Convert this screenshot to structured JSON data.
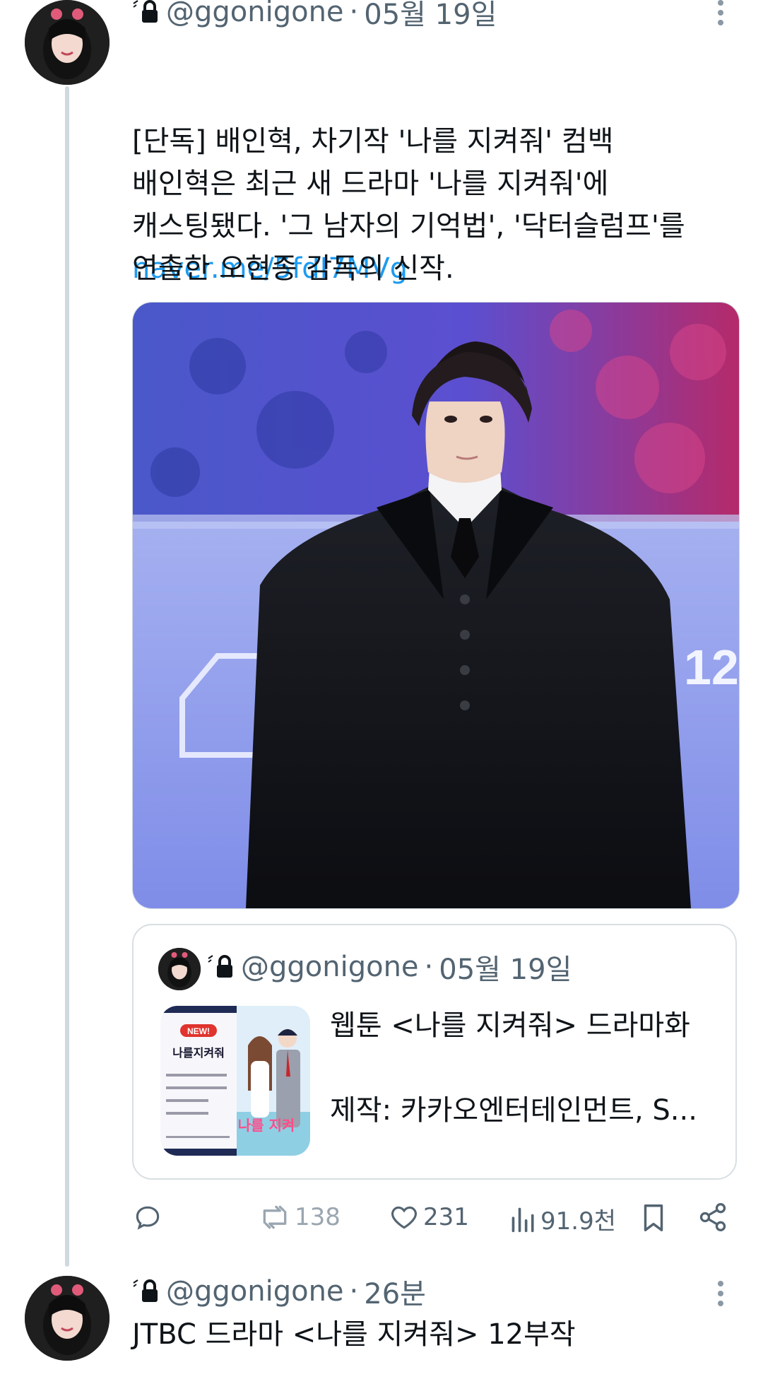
{
  "tweet1": {
    "handle": "@ggonigone",
    "dot": "·",
    "time": "05월 19일",
    "line1": "[단독] 배인혁, 차기작 '나를 지켜줘' 컴백",
    "link": "naver.me/5fdI7MVg",
    "body": "배인혁은 최근 새 드라마 '나를 지켜줘'에\n캐스팅됐다. '그 남자의 기억법', '닥터슬럼프'를\n연출한 오현종 감독의 신작.",
    "icons": [
      "more-vertical-icon",
      "lock-icon"
    ]
  },
  "photo": {
    "backdrop_text": "12"
  },
  "quote": {
    "handle": "@ggonigone",
    "dot": "·",
    "time": "05월 19일",
    "line1": "웹툰 <나를 지켜줘> 드라마화",
    "line2": "제작: 카카오엔터테인먼트, S...",
    "thumb_badge": "NEW!",
    "thumb_title": "나를지켜줘",
    "thumb_cover_text": "나를 지켜"
  },
  "actions": {
    "reply_count": "",
    "retweet_count": "138",
    "like_count": "231",
    "views_count": "91.9천",
    "icons": [
      "reply-icon",
      "retweet-icon",
      "heart-icon",
      "views-icon",
      "bookmark-icon",
      "share-icon"
    ]
  },
  "tweet2": {
    "handle": "@ggonigone",
    "dot": "·",
    "time": "26분",
    "text": "JTBC 드라마 <나를 지켜줘> 12부작"
  },
  "colors": {
    "link": "#1d9bf0",
    "muted": "#536471",
    "thread_line": "#cfd9de",
    "border": "#d8dfe3"
  }
}
